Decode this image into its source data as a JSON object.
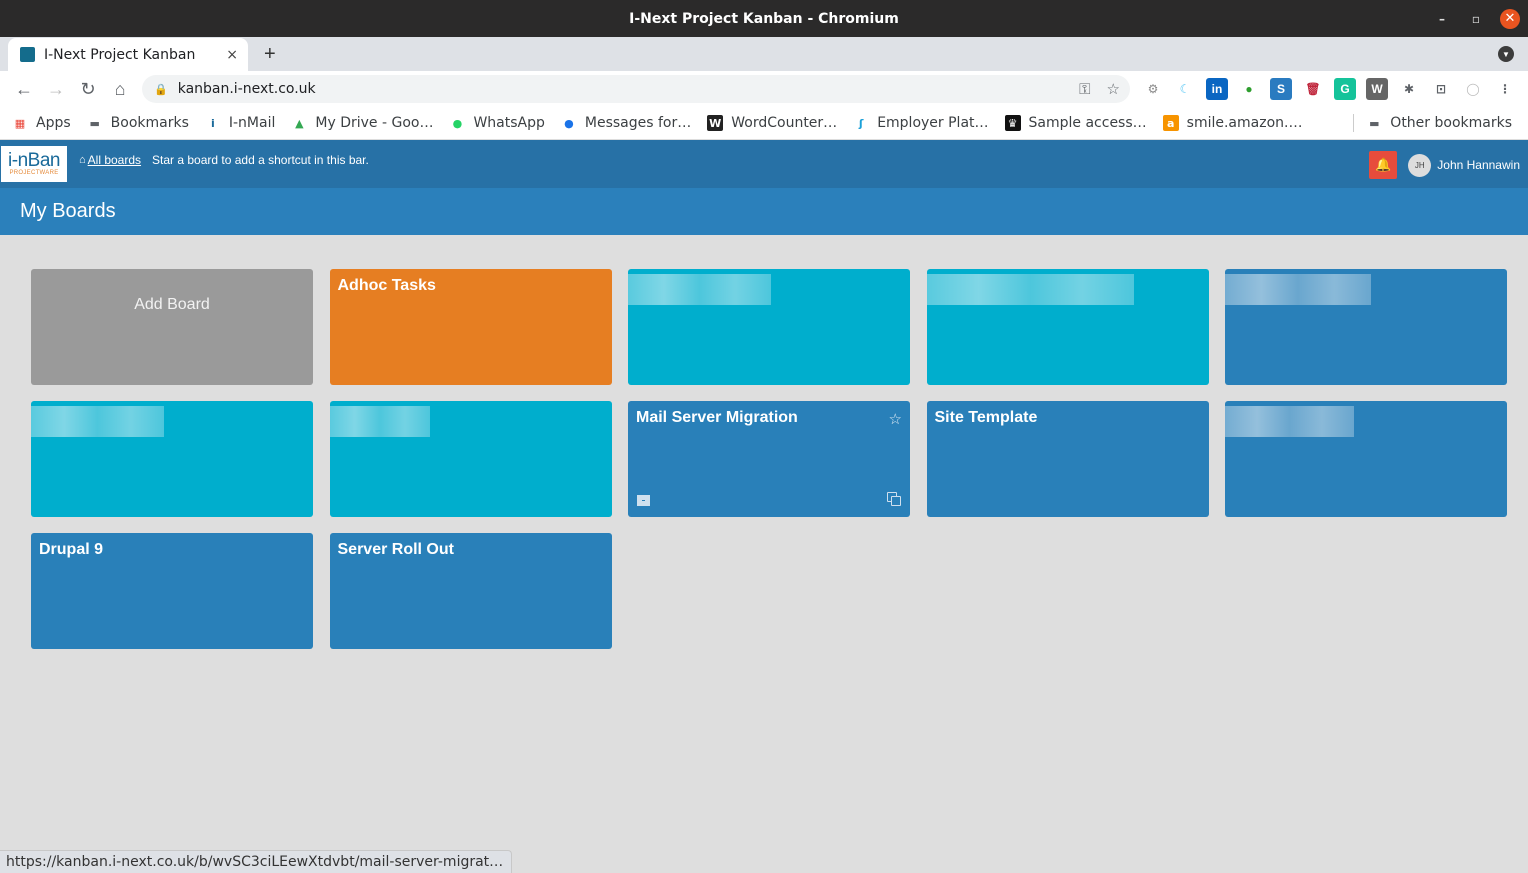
{
  "window": {
    "title": "I-Next Project Kanban - Chromium",
    "controls": {
      "minimize": "–",
      "restore": "▫",
      "close": "✕"
    }
  },
  "browser": {
    "tab": {
      "title": "I-Next Project Kanban",
      "close": "×"
    },
    "new_tab": "+",
    "tab_menu": "▼",
    "nav": {
      "back": "←",
      "forward": "→",
      "reload": "↻",
      "home": "⌂"
    },
    "url": "kanban.i-next.co.uk",
    "lock": "🔒",
    "key_icon": "⚿",
    "bookmark_star": "☆",
    "extensions": [
      {
        "name": "settings-extension-icon",
        "glyph": "⚙",
        "color": "#888888",
        "bg": "transparent"
      },
      {
        "name": "jquery-extension-icon",
        "glyph": "☾",
        "color": "#5bc8f5",
        "bg": "transparent"
      },
      {
        "name": "linkedin-extension-icon",
        "glyph": "in",
        "color": "#ffffff",
        "bg": "#0a66c2"
      },
      {
        "name": "green-dot-extension-icon",
        "glyph": "●",
        "color": "#2e9e2e",
        "bg": "transparent"
      },
      {
        "name": "s-extension-icon",
        "glyph": "S",
        "color": "#ffffff",
        "bg": "#2a7bc0"
      },
      {
        "name": "trash-extension-icon",
        "glyph": "🗑",
        "color": "#c0263c",
        "bg": "transparent"
      },
      {
        "name": "grammarly-extension-icon",
        "glyph": "G",
        "color": "#ffffff",
        "bg": "#15c39a"
      },
      {
        "name": "wordpress-extension-icon",
        "glyph": "W",
        "color": "#ffffff",
        "bg": "#666666"
      },
      {
        "name": "puzzle-extensions-icon",
        "glyph": "✱",
        "color": "#5f6368",
        "bg": "transparent"
      },
      {
        "name": "cast-icon",
        "glyph": "⊡",
        "color": "#5f6368",
        "bg": "transparent"
      },
      {
        "name": "profile-icon",
        "glyph": "◯",
        "color": "#bbbbbb",
        "bg": "transparent"
      },
      {
        "name": "menu-kebab-icon",
        "glyph": "⋮",
        "color": "#5f6368",
        "bg": "transparent"
      }
    ],
    "bookmarks": [
      {
        "label": "Apps",
        "icon": "▦",
        "icon_name": "apps-grid-icon",
        "color": "#e94235",
        "bg": "transparent"
      },
      {
        "label": "Bookmarks",
        "icon": "▬",
        "icon_name": "folder-icon",
        "color": "#5f6368",
        "bg": "transparent"
      },
      {
        "label": "I-nMail",
        "icon": "i",
        "icon_name": "inmail-icon",
        "color": "#1a6a9a",
        "bg": "transparent"
      },
      {
        "label": "My Drive - Goo…",
        "icon": "▲",
        "icon_name": "google-drive-icon",
        "color": "#34a853",
        "bg": "transparent"
      },
      {
        "label": "WhatsApp",
        "icon": "●",
        "icon_name": "whatsapp-icon",
        "color": "#25d366",
        "bg": "transparent"
      },
      {
        "label": "Messages for…",
        "icon": "●",
        "icon_name": "messages-icon",
        "color": "#1a73e8",
        "bg": "transparent"
      },
      {
        "label": "WordCounter…",
        "icon": "W",
        "icon_name": "wordcounter-icon",
        "color": "#ffffff",
        "bg": "#222222"
      },
      {
        "label": "Employer Plat…",
        "icon": "ʃ",
        "icon_name": "employer-platform-icon",
        "color": "#1ba0d8",
        "bg": "transparent"
      },
      {
        "label": "Sample access…",
        "icon": "♛",
        "icon_name": "gov-crown-icon",
        "color": "#ffffff",
        "bg": "#111111"
      },
      {
        "label": "smile.amazon.…",
        "icon": "a",
        "icon_name": "amazon-icon",
        "color": "#ffffff",
        "bg": "#f79400"
      }
    ],
    "other_bookmarks": {
      "label": "Other bookmarks",
      "icon": "▬"
    },
    "status_url": "https://kanban.i-next.co.uk/b/wvSC3ciLEewXtdvbt/mail-server-migrat…"
  },
  "app": {
    "logo": {
      "main": "i-nBan",
      "sub": "PROJECTWARE"
    },
    "all_boards": "All boards",
    "home_glyph": "⌂",
    "star_hint": "Star a board to add a shortcut in this bar.",
    "bell_glyph": "🔔",
    "user": {
      "initials": "JH",
      "name": "John Hannawin"
    },
    "page_title": "My Boards",
    "colors": {
      "header": "#2771a6",
      "title_bar": "#2b80bb",
      "orange": "#e67e22",
      "cyan": "#00aecd",
      "blue": "#2980b9",
      "add": "#9a9a9a",
      "alert": "#e74c3c"
    },
    "boards": [
      {
        "title": "Add Board",
        "kind": "add",
        "redacted": false
      },
      {
        "title": "Adhoc Tasks",
        "kind": "orange",
        "redacted": false
      },
      {
        "title": "",
        "kind": "cyan",
        "redacted": true
      },
      {
        "title": "",
        "kind": "cyan",
        "redacted": true
      },
      {
        "title": "",
        "kind": "blue",
        "redacted": true
      },
      {
        "title": "",
        "kind": "cyan",
        "redacted": true
      },
      {
        "title": "",
        "kind": "cyan",
        "redacted": true
      },
      {
        "title": "Mail Server Migration",
        "kind": "blue",
        "redacted": false,
        "hovered": true,
        "star": "☆"
      },
      {
        "title": "Site Template",
        "kind": "blue",
        "redacted": false
      },
      {
        "title": "",
        "kind": "blue",
        "redacted": true
      },
      {
        "title": "Drupal 9",
        "kind": "blue",
        "redacted": false
      },
      {
        "title": "Server Roll Out",
        "kind": "blue",
        "redacted": false
      }
    ]
  }
}
